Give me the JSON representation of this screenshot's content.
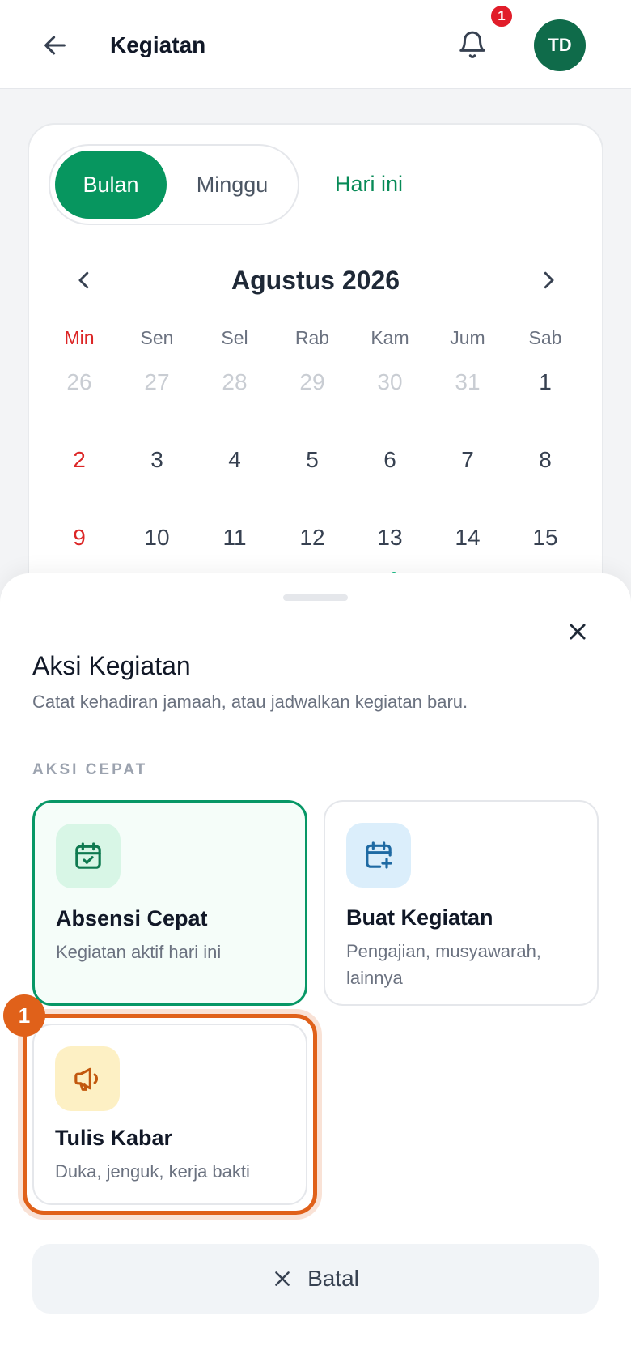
{
  "header": {
    "title": "Kegiatan",
    "notification_count": "1",
    "avatar_initials": "TD"
  },
  "calendar": {
    "view_toggle": {
      "month": "Bulan",
      "week": "Minggu",
      "active": "Bulan"
    },
    "today_label": "Hari ini",
    "month_label": "Agustus 2026",
    "weekdays": [
      "Min",
      "Sen",
      "Sel",
      "Rab",
      "Kam",
      "Jum",
      "Sab"
    ],
    "weeks": [
      [
        "26",
        "27",
        "28",
        "29",
        "30",
        "31",
        "1"
      ],
      [
        "2",
        "3",
        "4",
        "5",
        "6",
        "7",
        "8"
      ],
      [
        "9",
        "10",
        "11",
        "12",
        "13",
        "14",
        "15"
      ]
    ]
  },
  "sheet": {
    "title": "Aksi Kegiatan",
    "subtitle": "Catat kehadiran jamaah, atau jadwalkan kegiatan baru.",
    "section_label": "AKSI CEPAT",
    "actions": [
      {
        "title": "Absensi Cepat",
        "desc": "Kegiatan aktif hari ini",
        "icon": "calendar-check-icon"
      },
      {
        "title": "Buat Kegiatan",
        "desc": "Pengajian, musyawarah, lainnya",
        "icon": "calendar-plus-icon"
      },
      {
        "title": "Tulis Kabar",
        "desc": "Duka, jenguk, kerja bakti",
        "icon": "megaphone-icon"
      }
    ],
    "step_badge": "1",
    "cancel_label": "Batal"
  },
  "colors": {
    "brand_green": "#07965f",
    "sunday_red": "#dc2626",
    "highlight_orange": "#e0611a"
  }
}
